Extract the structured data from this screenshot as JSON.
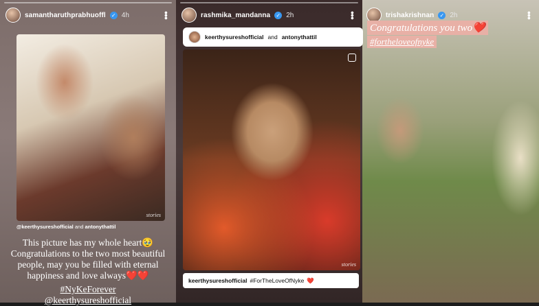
{
  "story1": {
    "username": "samantharuthprabhuoffl",
    "time": "4h",
    "tag_user1": "@keerthysureshofficial",
    "tag_and": "and",
    "tag_user2": "antonythattil",
    "caption": "This picture has my whole heart🥹 Congratulations to the two most beautiful people, may you be filled with eternal happiness and love always❤️❤️",
    "hashtag": "#NyKeForever",
    "mention": "@keerthysureshofficial",
    "watermark": "stories"
  },
  "story2": {
    "username": "rashmika_mandanna",
    "time": "2h",
    "mention_user1": "keerthysureshofficial",
    "mention_and": "and",
    "mention_user2": "antonythattil",
    "post_user": "keerthysureshofficial",
    "post_tag": "#ForTheLoveOfNyke",
    "heart": "❤️",
    "watermark": "stories"
  },
  "story3": {
    "username": "trishakrishnan",
    "time": "2h",
    "caption_line1": "Congratulations you two❤️",
    "caption_line2": "#fortheloveofnyke"
  },
  "colors": {
    "verified": "#3897f0",
    "caption_highlight": "#e8b0a6",
    "heart": "#e0245e"
  }
}
